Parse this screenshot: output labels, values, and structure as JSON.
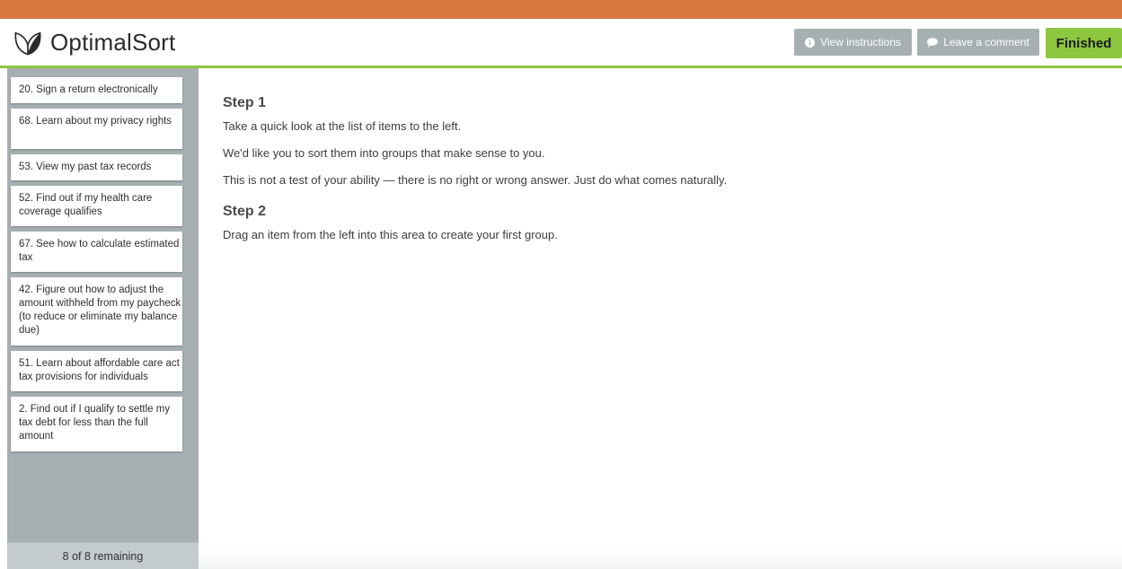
{
  "app": {
    "name": "OptimalSort"
  },
  "header": {
    "view_instructions": "View instructions",
    "leave_comment": "Leave a comment",
    "finished": "Finished"
  },
  "cards": [
    "20. Sign a return electronically",
    "68. Learn about my privacy rights",
    "53. View my past tax records",
    "52. Find out if my health care coverage qualifies",
    "67. See how to calculate estimated tax",
    "42. Figure out how to adjust the amount withheld from my paycheck (to reduce or eliminate my balance due)",
    "51. Learn about affordable care act tax provisions for individuals",
    "2. Find out if I qualify to settle my tax debt for less than the full amount"
  ],
  "remaining": "8 of 8 remaining",
  "instructions": {
    "step1_title": "Step 1",
    "step1_lines": [
      "Take a quick look at the list of items to the left.",
      "We'd like you to sort them into groups that make sense to you.",
      "This is not a test of your ability — there is no right or wrong answer. Just do what comes naturally."
    ],
    "step2_title": "Step 2",
    "step2_line": "Drag an item from the left into this area to create your first group."
  },
  "colors": {
    "topbar": "#d8783f",
    "accent_green": "#8dc63f",
    "sidebar_bg": "#a6b0b3",
    "header_button": "#a6b0b3"
  }
}
